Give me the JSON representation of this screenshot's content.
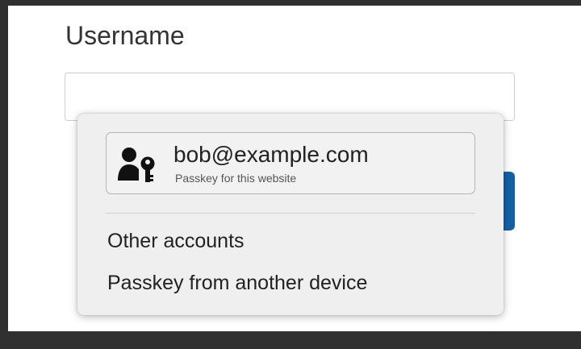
{
  "form": {
    "username_label": "Username",
    "username_value": ""
  },
  "autofill_popup": {
    "account": {
      "email": "bob@example.com",
      "subtitle": "Passkey for this website",
      "icon": "person-key-icon"
    },
    "options": [
      {
        "label": "Other accounts"
      },
      {
        "label": "Passkey from another device"
      }
    ]
  },
  "colors": {
    "button": "#1261a6",
    "popup_background": "#efefef",
    "frame": "#303030"
  }
}
